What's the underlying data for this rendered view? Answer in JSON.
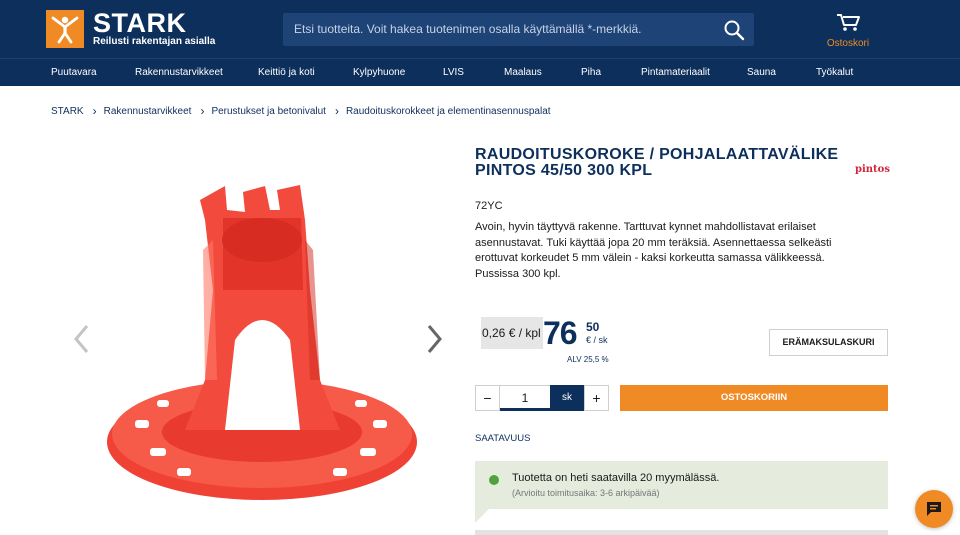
{
  "header": {
    "logo_name": "STARK",
    "logo_tagline": "Reilusti rakentajan asialla",
    "search_placeholder": "Etsi tuotteita. Voit hakea tuotenimen osalla käyttämällä *-merkkiä.",
    "cart_label": "Ostoskori"
  },
  "nav": {
    "items": [
      "Puutavara",
      "Rakennustarvikkeet",
      "Keittiö ja koti",
      "Kylpyhuone",
      "LVIS",
      "Maalaus",
      "Piha",
      "Pintamateriaalit",
      "Sauna",
      "Työkalut"
    ]
  },
  "breadcrumb": [
    "STARK",
    "Rakennustarvikkeet",
    "Perustukset ja betonivalut",
    "Raudoituskorokkeet ja elementinasennuspalat"
  ],
  "product": {
    "title": "RAUDOITUSKOROKE / POHJALAATTAVÄLIKE PINTOS 45/50 300 KPL",
    "brand": "pintos",
    "sku": "72YC",
    "description": "Avoin, hyvin täyttyvä rakenne. Tarttuvat kynnet mahdollistavat erilaiset asennustavat. Tuki käyttää jopa 20 mm teräksiä. Asennettaessa selkeästi erottuvat korkeudet 5 mm välein - kaksi korkeutta samassa välikkeessä. Pussissa 300 kpl.",
    "unit_price": "0,26 € / kpl",
    "price_whole": "76",
    "price_decimals": "50",
    "price_unit": "€ / sk",
    "vat": "ALV 25,5 %",
    "installment_label": "ERÄMAKSULASKURI",
    "qty_minus": "−",
    "qty_value": "1",
    "qty_unit": "sk",
    "qty_plus": "+",
    "add_to_cart": "OSTOSKORIIN",
    "availability_label": "SAATAVUUS",
    "availability_main": "Tuotetta on heti saatavilla 20 myymälässä.",
    "availability_sub": "(Arvioitu toimitusaika: 3-6 arkipäivää)"
  },
  "colors": {
    "navy": "#0d2f5c",
    "orange": "#f08a24",
    "product_red": "#f24a3c",
    "availability_green": "#4ea33b"
  }
}
